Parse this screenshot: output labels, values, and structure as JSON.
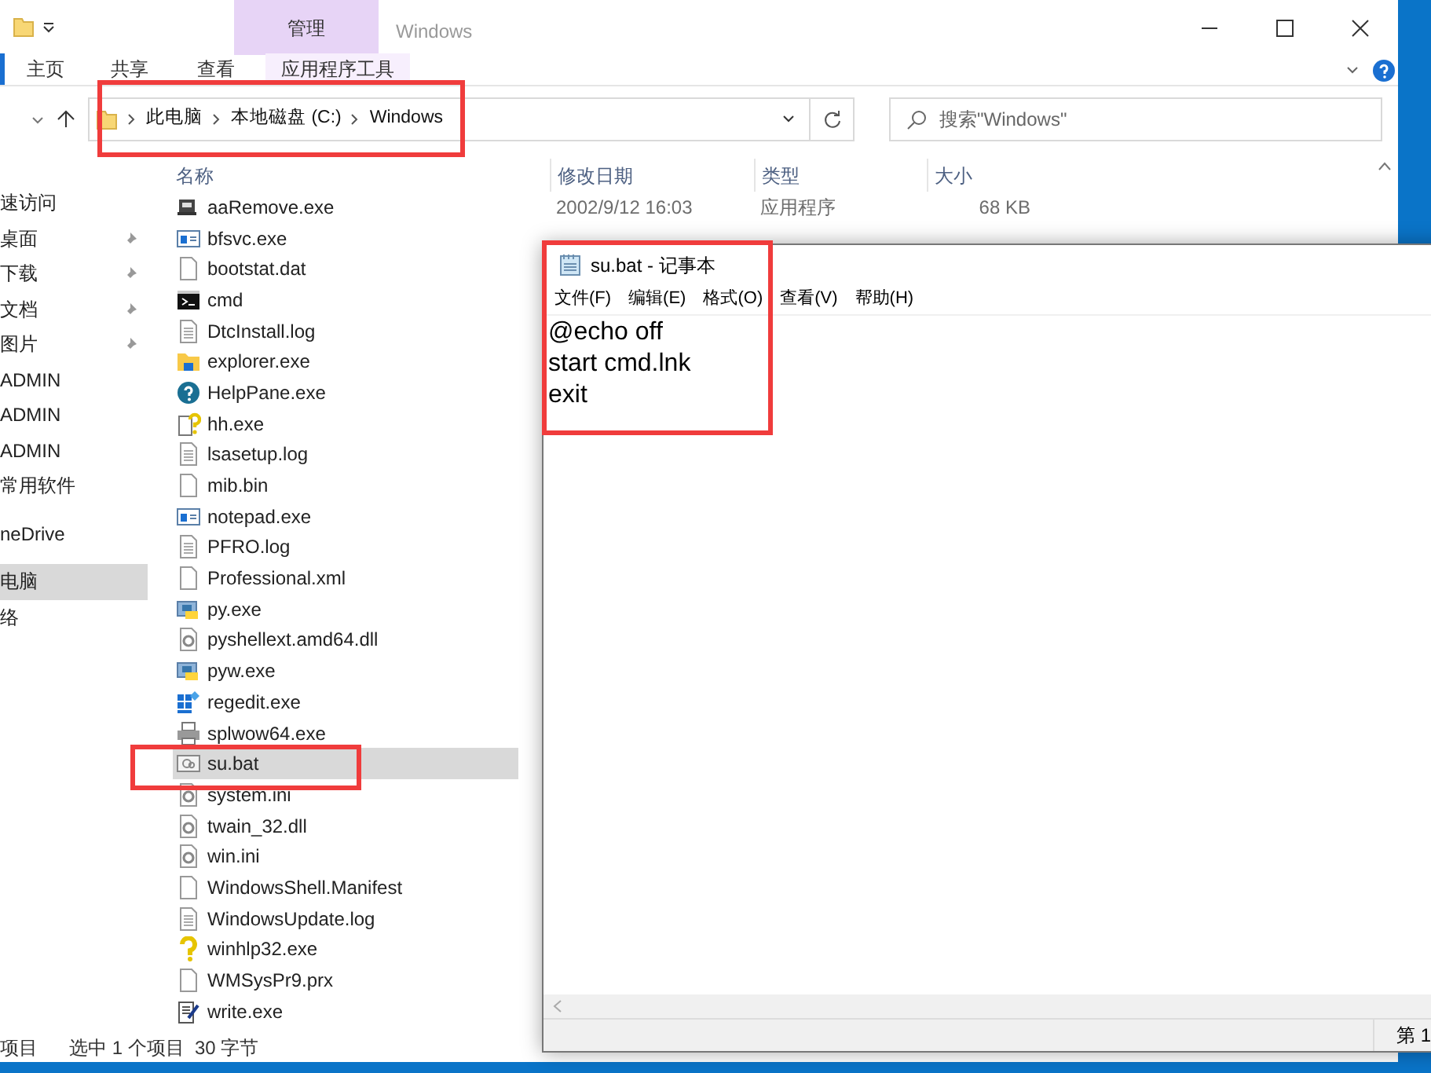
{
  "explorer": {
    "title": "Windows",
    "context_tab": "管理",
    "ribbon_tabs": [
      {
        "label": "主页",
        "selected": false
      },
      {
        "label": "共享",
        "selected": false
      },
      {
        "label": "查看",
        "selected": false
      },
      {
        "label": "应用程序工具",
        "selected": false
      }
    ],
    "breadcrumb": [
      "此电脑",
      "本地磁盘 (C:)",
      "Windows"
    ],
    "search": {
      "placeholder": "搜索\"Windows\""
    },
    "sidebar": [
      {
        "label": "速访问",
        "pinned": false,
        "selected": false
      },
      {
        "label": "桌面",
        "pinned": true,
        "selected": false
      },
      {
        "label": "下载",
        "pinned": true,
        "selected": false
      },
      {
        "label": "文档",
        "pinned": true,
        "selected": false
      },
      {
        "label": "图片",
        "pinned": true,
        "selected": false
      },
      {
        "label": "ADMIN",
        "pinned": false,
        "selected": false
      },
      {
        "label": "ADMIN",
        "pinned": false,
        "selected": false
      },
      {
        "label": "ADMIN",
        "pinned": false,
        "selected": false
      },
      {
        "label": "常用软件",
        "pinned": false,
        "selected": false
      },
      {
        "label": "neDrive",
        "pinned": false,
        "selected": false,
        "gap": true
      },
      {
        "label": "电脑",
        "pinned": false,
        "selected": true,
        "gap": true
      },
      {
        "label": "络",
        "pinned": false,
        "selected": false
      }
    ],
    "columns": [
      "名称",
      "修改日期",
      "类型",
      "大小"
    ],
    "files": [
      {
        "name": "aaRemove.exe",
        "kind": "remover",
        "selected": false,
        "date": "2002/9/12 16:03",
        "type": "应用程序",
        "size": "68 KB"
      },
      {
        "name": "bfsvc.exe",
        "kind": "app",
        "selected": false
      },
      {
        "name": "bootstat.dat",
        "kind": "blank",
        "selected": false
      },
      {
        "name": "cmd",
        "kind": "console",
        "selected": false
      },
      {
        "name": "DtcInstall.log",
        "kind": "text",
        "selected": false
      },
      {
        "name": "explorer.exe",
        "kind": "folder",
        "selected": false
      },
      {
        "name": "HelpPane.exe",
        "kind": "help",
        "selected": false
      },
      {
        "name": "hh.exe",
        "kind": "helpdoc",
        "selected": false
      },
      {
        "name": "lsasetup.log",
        "kind": "text",
        "selected": false
      },
      {
        "name": "mib.bin",
        "kind": "blank",
        "selected": false
      },
      {
        "name": "notepad.exe",
        "kind": "app",
        "selected": false
      },
      {
        "name": "PFRO.log",
        "kind": "text",
        "selected": false
      },
      {
        "name": "Professional.xml",
        "kind": "blank",
        "selected": false
      },
      {
        "name": "py.exe",
        "kind": "python",
        "selected": false
      },
      {
        "name": "pyshellext.amd64.dll",
        "kind": "gearfile",
        "selected": false
      },
      {
        "name": "pyw.exe",
        "kind": "python",
        "selected": false
      },
      {
        "name": "regedit.exe",
        "kind": "registry",
        "selected": false
      },
      {
        "name": "splwow64.exe",
        "kind": "printer",
        "selected": false
      },
      {
        "name": "su.bat",
        "kind": "batch",
        "selected": true
      },
      {
        "name": "system.ini",
        "kind": "gearfile",
        "selected": false
      },
      {
        "name": "twain_32.dll",
        "kind": "gearfile",
        "selected": false
      },
      {
        "name": "win.ini",
        "kind": "gearfile",
        "selected": false
      },
      {
        "name": "WindowsShell.Manifest",
        "kind": "blank",
        "selected": false
      },
      {
        "name": "WindowsUpdate.log",
        "kind": "text",
        "selected": false
      },
      {
        "name": "winhlp32.exe",
        "kind": "question",
        "selected": false
      },
      {
        "name": "WMSysPr9.prx",
        "kind": "blank",
        "selected": false
      },
      {
        "name": "write.exe",
        "kind": "writer",
        "selected": false
      }
    ],
    "status_bar": [
      "项目",
      "选中 1 个项目  30 字节"
    ]
  },
  "notepad": {
    "title": "su.bat - 记事本",
    "menu": [
      "文件(F)",
      "编辑(E)",
      "格式(O)",
      "查看(V)",
      "帮助(H)"
    ],
    "lines": [
      "@echo off",
      "start cmd.lnk",
      "exit"
    ],
    "status": "第 1"
  }
}
